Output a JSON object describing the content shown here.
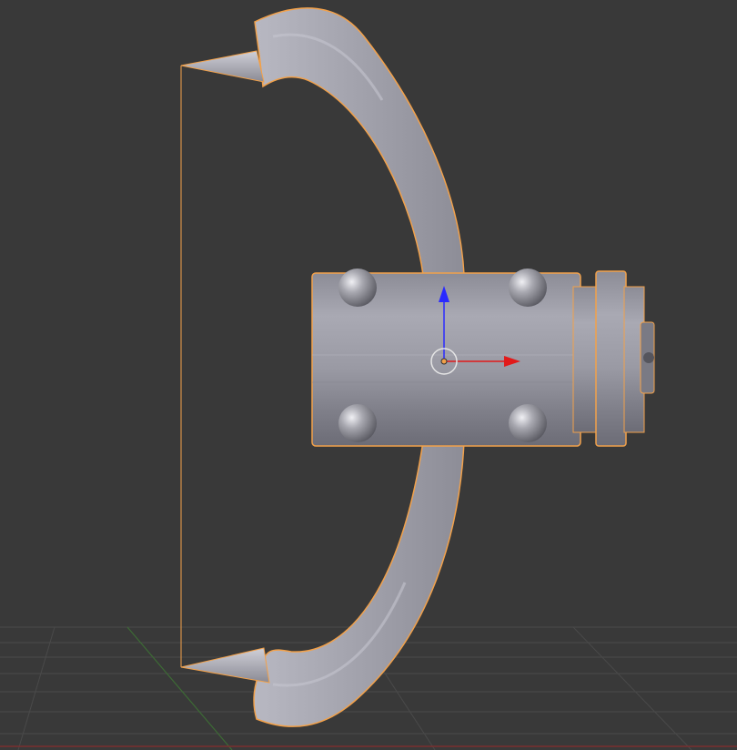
{
  "viewport": {
    "background_color": "#393939",
    "grid_line_color": "#4a4a4a",
    "y_axis_color": "#3d6b35",
    "x_axis_color": "#7a2f2f",
    "selection_outline_color": "#f2a14a",
    "mesh_color": "#a6a6b0"
  },
  "object": {
    "shape": "spiked-cylinder-with-curved-blades",
    "selected": true
  },
  "gizmo": {
    "z_axis_color": "#2a2aff",
    "x_axis_color": "#e21a1a",
    "center_ring_color": "#e6e6e6",
    "origin_dot_color": "#f2a14a"
  }
}
